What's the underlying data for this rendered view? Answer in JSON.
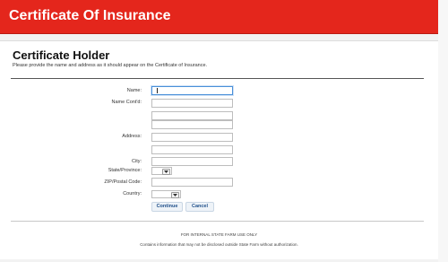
{
  "header": {
    "title": "Certificate Of Insurance"
  },
  "section": {
    "title": "Certificate Holder",
    "description": "Please provide the name and address as it should appear on the Certificate of Insurance."
  },
  "form": {
    "name_label": "Name:",
    "name_contd_label": "Name Cont'd:",
    "address_label": "Address:",
    "city_label": "City:",
    "state_label": "State/Province:",
    "zip_label": "ZIP/Postal Code:",
    "country_label": "Country:",
    "name_value": "",
    "name_contd_value_1": "",
    "name_contd_value_2": "",
    "address_value_1": "",
    "address_value_2": "",
    "address_value_3": "",
    "city_value": "",
    "zip_value": "",
    "state_selected": "",
    "country_selected": ""
  },
  "buttons": {
    "continue_label": "Continue",
    "cancel_label": "Cancel"
  },
  "footer": {
    "line1": "FOR INTERNAL STATE FARM USE ONLY",
    "line2": "Contains information that may not be disclosed outside State Farm without authorization."
  },
  "colors": {
    "banner": "#e4261c",
    "focus": "#4a90d9",
    "button_text": "#1f4f8a"
  }
}
